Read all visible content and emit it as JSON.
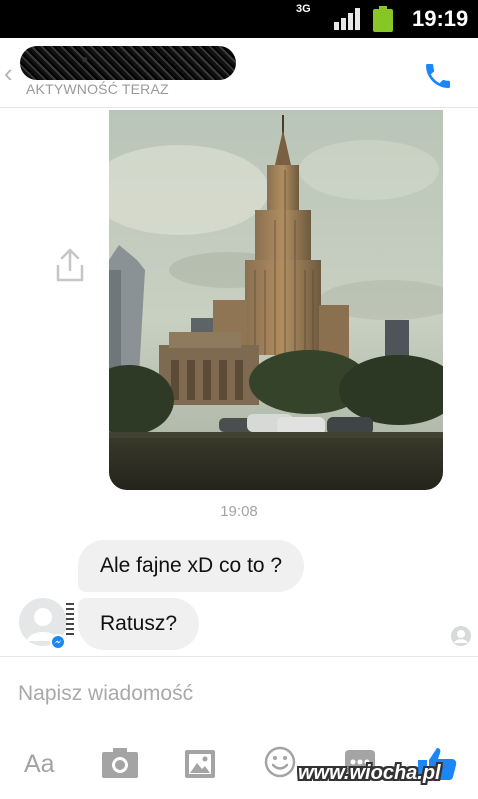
{
  "status_bar": {
    "network": "3G",
    "time": "19:19"
  },
  "header": {
    "contact_name": "",
    "status": "AKTYWNOŚĆ TERAZ"
  },
  "conversation": {
    "timestamp": "19:08",
    "messages": [
      {
        "text": "Ale fajne xD co to ?"
      },
      {
        "text": "Ratusz?"
      }
    ]
  },
  "composer": {
    "placeholder": "Napisz wiadomość",
    "value": "",
    "tools": {
      "text_label": "Aa"
    }
  },
  "watermark": "www.wiocha.pl",
  "colors": {
    "accent": "#1b86f7",
    "bubble": "#f0f0f0",
    "muted": "#a3a3a3",
    "status_bar": "#000000"
  },
  "icons": [
    "back-icon",
    "phone-icon",
    "share-icon",
    "camera-icon",
    "gallery-icon",
    "emoji-icon",
    "more-icon",
    "like-icon",
    "seen-icon",
    "messenger-icon"
  ]
}
